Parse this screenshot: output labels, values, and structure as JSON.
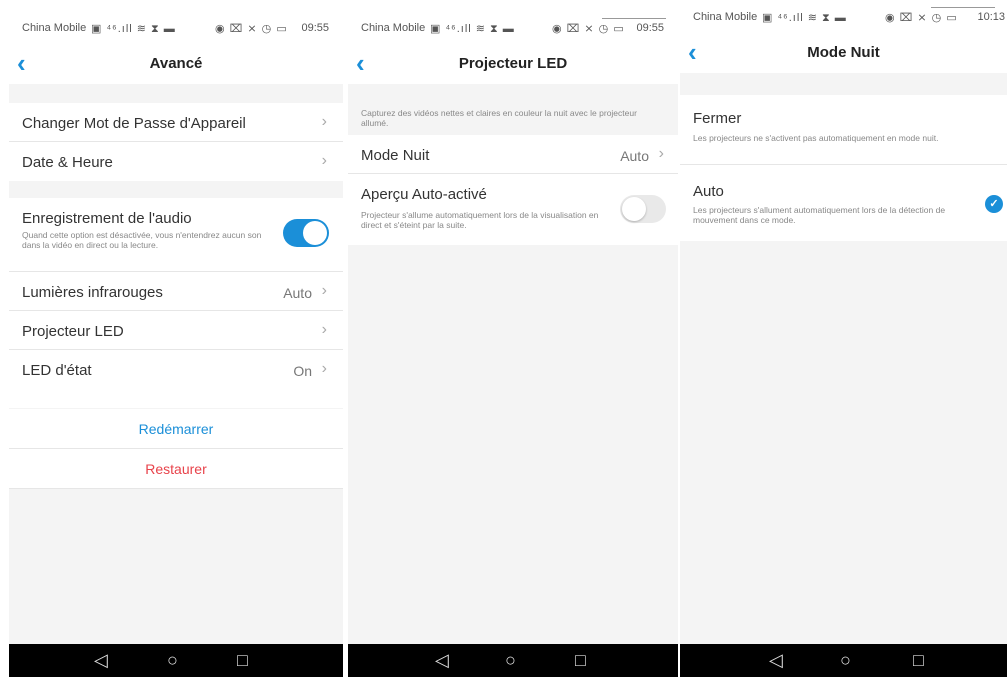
{
  "status": {
    "carrier": "China Mobile",
    "icons": "▣ ⁴⁶.ıll ≋ ⧗ ▬",
    "right_icons": "◉ ⌧ ⨯ ◷ ▭",
    "s1_time": "09:55",
    "s2_time": "09:55",
    "s3_time": "10:13"
  },
  "s1": {
    "title": "Avancé",
    "rows": {
      "password": "Changer Mot de Passe d'Appareil",
      "datetime": "Date & Heure",
      "audio_label": "Enregistrement de l'audio",
      "audio_desc": "Quand cette option est désactivée, vous n'entendrez aucun son dans la vidéo en direct ou la lecture.",
      "infrared": "Lumières infrarouges",
      "infrared_value": "Auto",
      "led_projector": "Projecteur LED",
      "status_led": "LED d'état",
      "status_led_value": "On"
    },
    "reboot": "Redémarrer",
    "restore": "Restaurer"
  },
  "s2": {
    "title": "Projecteur LED",
    "desc": "Capturez des vidéos nettes et claires en couleur la nuit avec le projecteur allumé.",
    "night_mode": "Mode Nuit",
    "night_mode_value": "Auto",
    "preview_label": "Aperçu Auto-activé",
    "preview_desc": "Projecteur s'allume automatiquement lors de la visualisation en direct et s'éteint par la suite."
  },
  "s3": {
    "title": "Mode Nuit",
    "off_label": "Fermer",
    "off_desc": "Les projecteurs ne s'activent pas automatiquement en mode nuit.",
    "auto_label": "Auto",
    "auto_desc": "Les projecteurs s'allument automatiquement lors de la détection de mouvement dans ce mode."
  },
  "glyphs": {
    "back": "‹",
    "chevron": "›",
    "check": "✓",
    "nav_back": "◁",
    "nav_home": "○",
    "nav_recent": "□"
  },
  "colors": {
    "accent": "#1b8fd8",
    "reboot": "#1b8fd8",
    "restore": "#e8434b"
  }
}
